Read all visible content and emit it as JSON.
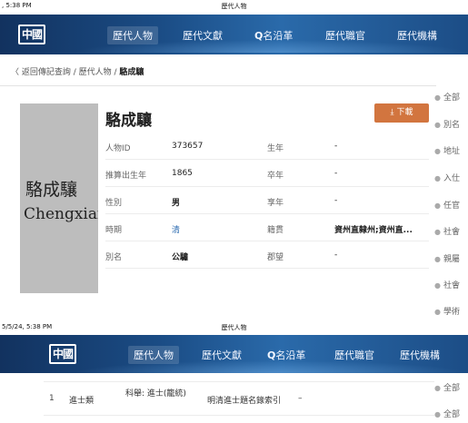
{
  "status_top": {
    "time": ", 5:38 PM",
    "title": "歷代人物"
  },
  "status_bottom": {
    "time": "5/5/24, 5:38 PM",
    "title": "歷代人物"
  },
  "logo": "中國",
  "nav": {
    "items": [
      "歷代人物",
      "歷代文獻",
      "名沿革",
      "歷代職官",
      "歷代機構"
    ],
    "search_glyph": "Q"
  },
  "breadcrumb": {
    "back": "〈 返回傳記查詢 / 歷代人物 / ",
    "current": "駱成驤"
  },
  "photo": {
    "name_cn": "駱成驤",
    "name_en": "Chengxiang"
  },
  "person": {
    "name": "駱成驤"
  },
  "download": {
    "icon": "⤓",
    "label": "下載"
  },
  "fields": [
    {
      "l1": "人物ID",
      "v1": "373657",
      "l2": "生年",
      "v2": "-"
    },
    {
      "l1": "推算出生年",
      "v1": "1865",
      "l2": "卒年",
      "v2": "-"
    },
    {
      "l1": "性別",
      "v1": "男",
      "l2": "享年",
      "v2": "-"
    },
    {
      "l1": "時期",
      "v1": "清",
      "l2": "籍貫",
      "v2": "資州直隸州;資州直..."
    },
    {
      "l1": "別名",
      "v1": "公驌",
      "l2": "郡望",
      "v2": "-"
    }
  ],
  "side_links": [
    "全部",
    "別名",
    "地址",
    "入仕",
    "任官",
    "社會",
    "親屬",
    "社會",
    "學術"
  ],
  "side_links_bottom": [
    "全部",
    "全部"
  ],
  "exam_row": {
    "num": "1",
    "type": "進士類",
    "exam": "科舉: 進士(籠統)",
    "source": "明清進士題名錄索引",
    "dash": "–"
  }
}
